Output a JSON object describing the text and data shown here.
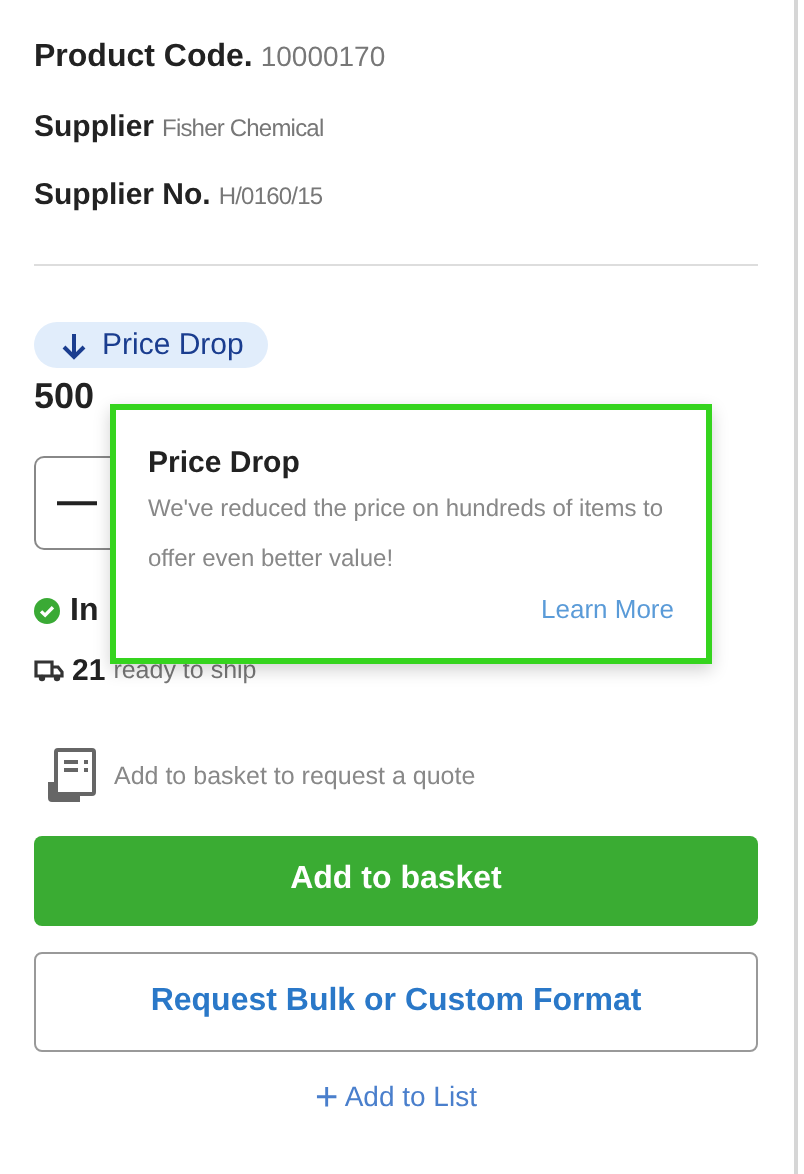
{
  "details": [
    {
      "label": "Product Code.",
      "value": "10000170",
      "kind": "main"
    },
    {
      "label": "Supplier",
      "value": "Fisher Chemical",
      "kind": "sub"
    },
    {
      "label": "Supplier No.",
      "value": "H/0160/15",
      "kind": "sub"
    }
  ],
  "badge": {
    "label": "Price Drop"
  },
  "price": "500",
  "quantity": {
    "minus": "—"
  },
  "stock": {
    "status": "In",
    "count": "21",
    "shipping": "ready to ship"
  },
  "quote_note": "Add to basket to request a quote",
  "buttons": [
    {
      "label": "Add to basket",
      "kind": "primary"
    },
    {
      "label": "Request Bulk or Custom Format",
      "kind": "secondary"
    }
  ],
  "add_to_list": {
    "icon": "+",
    "label": "Add to List"
  },
  "tooltip": {
    "title": "Price Drop",
    "body": "We've reduced the price on hundreds of items to offer even better value!",
    "link": "Learn More",
    "highlighted": true
  }
}
